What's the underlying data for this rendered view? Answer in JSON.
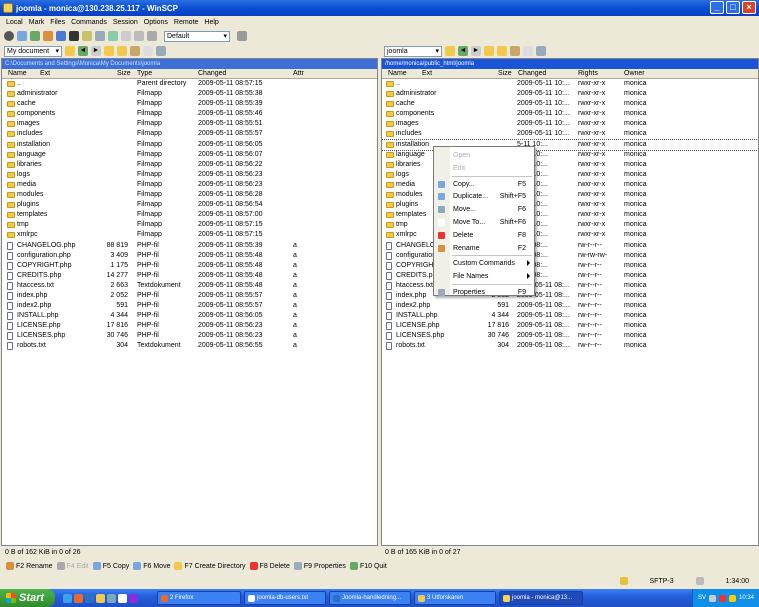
{
  "window": {
    "title": "joomla - monica@130.238.25.117 - WinSCP"
  },
  "menu": [
    "Local",
    "Mark",
    "Files",
    "Commands",
    "Session",
    "Options",
    "Remote",
    "Help"
  ],
  "toolbar": {
    "transfer_setting": "Default"
  },
  "left_path": {
    "drive": "My document"
  },
  "right_path": {
    "folder": "joomla"
  },
  "left_panel": {
    "address": "C:\\Documents and Settings\\Monica\\My Documents\\joomla",
    "columns": [
      "Name",
      "Ext",
      "Size",
      "Type",
      "Changed",
      "Attr"
    ],
    "rows": [
      {
        "name": "..",
        "ext": "",
        "size": "",
        "type": "Parent directory",
        "changed": "2009-05-11 08:57:15",
        "attr": "",
        "kind": "updir"
      },
      {
        "name": "administrator",
        "ext": "",
        "size": "",
        "type": "Filmapp",
        "changed": "2009-05-11 08:55:38",
        "attr": "",
        "kind": "folder"
      },
      {
        "name": "cache",
        "ext": "",
        "size": "",
        "type": "Filmapp",
        "changed": "2009-05-11 08:55:39",
        "attr": "",
        "kind": "folder"
      },
      {
        "name": "components",
        "ext": "",
        "size": "",
        "type": "Filmapp",
        "changed": "2009-05-11 08:55:46",
        "attr": "",
        "kind": "folder"
      },
      {
        "name": "images",
        "ext": "",
        "size": "",
        "type": "Filmapp",
        "changed": "2009-05-11 08:55:51",
        "attr": "",
        "kind": "folder"
      },
      {
        "name": "includes",
        "ext": "",
        "size": "",
        "type": "Filmapp",
        "changed": "2009-05-11 08:55:57",
        "attr": "",
        "kind": "folder"
      },
      {
        "name": "installation",
        "ext": "",
        "size": "",
        "type": "Filmapp",
        "changed": "2009-05-11 08:56:05",
        "attr": "",
        "kind": "folder"
      },
      {
        "name": "language",
        "ext": "",
        "size": "",
        "type": "Filmapp",
        "changed": "2009-05-11 08:56:07",
        "attr": "",
        "kind": "folder"
      },
      {
        "name": "libraries",
        "ext": "",
        "size": "",
        "type": "Filmapp",
        "changed": "2009-05-11 08:56:22",
        "attr": "",
        "kind": "folder"
      },
      {
        "name": "logs",
        "ext": "",
        "size": "",
        "type": "Filmapp",
        "changed": "2009-05-11 08:56:23",
        "attr": "",
        "kind": "folder"
      },
      {
        "name": "media",
        "ext": "",
        "size": "",
        "type": "Filmapp",
        "changed": "2009-05-11 08:56:23",
        "attr": "",
        "kind": "folder"
      },
      {
        "name": "modules",
        "ext": "",
        "size": "",
        "type": "Filmapp",
        "changed": "2009-05-11 08:56:28",
        "attr": "",
        "kind": "folder"
      },
      {
        "name": "plugins",
        "ext": "",
        "size": "",
        "type": "Filmapp",
        "changed": "2009-05-11 08:56:54",
        "attr": "",
        "kind": "folder"
      },
      {
        "name": "templates",
        "ext": "",
        "size": "",
        "type": "Filmapp",
        "changed": "2009-05-11 08:57:00",
        "attr": "",
        "kind": "folder"
      },
      {
        "name": "tmp",
        "ext": "",
        "size": "",
        "type": "Filmapp",
        "changed": "2009-05-11 08:57:15",
        "attr": "",
        "kind": "folder"
      },
      {
        "name": "xmlrpc",
        "ext": "",
        "size": "",
        "type": "Filmapp",
        "changed": "2009-05-11 08:57:15",
        "attr": "",
        "kind": "folder"
      },
      {
        "name": "CHANGELOG.php",
        "ext": "",
        "size": "88 819",
        "type": "PHP-fil",
        "changed": "2009-05-11 08:55:39",
        "attr": "a",
        "kind": "file"
      },
      {
        "name": "configuration.php",
        "ext": "",
        "size": "3 409",
        "type": "PHP-fil",
        "changed": "2009-05-11 08:55:48",
        "attr": "a",
        "kind": "file"
      },
      {
        "name": "COPYRIGHT.php",
        "ext": "",
        "size": "1 175",
        "type": "PHP-fil",
        "changed": "2009-05-11 08:55:48",
        "attr": "a",
        "kind": "file"
      },
      {
        "name": "CREDITS.php",
        "ext": "",
        "size": "14 277",
        "type": "PHP-fil",
        "changed": "2009-05-11 08:55:48",
        "attr": "a",
        "kind": "file"
      },
      {
        "name": "htaccess.txt",
        "ext": "",
        "size": "2 663",
        "type": "Textdokument",
        "changed": "2009-05-11 08:55:48",
        "attr": "a",
        "kind": "file"
      },
      {
        "name": "index.php",
        "ext": "",
        "size": "2 052",
        "type": "PHP-fil",
        "changed": "2009-05-11 08:55:57",
        "attr": "a",
        "kind": "file"
      },
      {
        "name": "index2.php",
        "ext": "",
        "size": "591",
        "type": "PHP-fil",
        "changed": "2009-05-11 08:55:57",
        "attr": "a",
        "kind": "file"
      },
      {
        "name": "INSTALL.php",
        "ext": "",
        "size": "4 344",
        "type": "PHP-fil",
        "changed": "2009-05-11 08:56:05",
        "attr": "a",
        "kind": "file"
      },
      {
        "name": "LICENSE.php",
        "ext": "",
        "size": "17 816",
        "type": "PHP-fil",
        "changed": "2009-05-11 08:56:23",
        "attr": "a",
        "kind": "file"
      },
      {
        "name": "LICENSES.php",
        "ext": "",
        "size": "30 746",
        "type": "PHP-fil",
        "changed": "2009-05-11 08:56:23",
        "attr": "a",
        "kind": "file"
      },
      {
        "name": "robots.txt",
        "ext": "",
        "size": "304",
        "type": "Textdokument",
        "changed": "2009-05-11 08:56:55",
        "attr": "a",
        "kind": "file"
      }
    ],
    "status": "0 B of 162 KiB in 0 of 26"
  },
  "right_panel": {
    "address": "/home/monica/public_html/joomla",
    "columns": [
      "Name",
      "Ext",
      "Size",
      "Changed",
      "Rights",
      "Owner"
    ],
    "rows": [
      {
        "name": "..",
        "size": "",
        "changed": "2009-05-11 10:...",
        "rights": "rwxr-xr-x",
        "owner": "monica",
        "kind": "updir"
      },
      {
        "name": "administrator",
        "size": "",
        "changed": "2009-05-11 10:...",
        "rights": "rwxr-xr-x",
        "owner": "monica",
        "kind": "folder"
      },
      {
        "name": "cache",
        "size": "",
        "changed": "2009-05-11 10:...",
        "rights": "rwxr-xr-x",
        "owner": "monica",
        "kind": "folder"
      },
      {
        "name": "components",
        "size": "",
        "changed": "2009-05-11 10:...",
        "rights": "rwxr-xr-x",
        "owner": "monica",
        "kind": "folder"
      },
      {
        "name": "images",
        "size": "",
        "changed": "2009-05-11 10:...",
        "rights": "rwxr-xr-x",
        "owner": "monica",
        "kind": "folder"
      },
      {
        "name": "includes",
        "size": "",
        "changed": "2009-05-11 10:...",
        "rights": "rwxr-xr-x",
        "owner": "monica",
        "kind": "folder"
      },
      {
        "name": "installation",
        "size": "",
        "changed": "5-11 10:...",
        "rights": "rwxr-xr-x",
        "owner": "monica",
        "kind": "folder",
        "selected": true
      },
      {
        "name": "language",
        "size": "",
        "changed": "5-11 10:...",
        "rights": "rwxr-xr-x",
        "owner": "monica",
        "kind": "folder"
      },
      {
        "name": "libraries",
        "size": "",
        "changed": "5-11 10:...",
        "rights": "rwxr-xr-x",
        "owner": "monica",
        "kind": "folder"
      },
      {
        "name": "logs",
        "size": "",
        "changed": "5-11 10:...",
        "rights": "rwxr-xr-x",
        "owner": "monica",
        "kind": "folder"
      },
      {
        "name": "media",
        "size": "",
        "changed": "5-11 10:...",
        "rights": "rwxr-xr-x",
        "owner": "monica",
        "kind": "folder"
      },
      {
        "name": "modules",
        "size": "",
        "changed": "5-11 10:...",
        "rights": "rwxr-xr-x",
        "owner": "monica",
        "kind": "folder"
      },
      {
        "name": "plugins",
        "size": "",
        "changed": "5-11 10:...",
        "rights": "rwxr-xr-x",
        "owner": "monica",
        "kind": "folder"
      },
      {
        "name": "templates",
        "size": "",
        "changed": "5-11 10:...",
        "rights": "rwxr-xr-x",
        "owner": "monica",
        "kind": "folder"
      },
      {
        "name": "tmp",
        "size": "",
        "changed": "5-11 10:...",
        "rights": "rwxr-xr-x",
        "owner": "monica",
        "kind": "folder"
      },
      {
        "name": "xmlrpc",
        "size": "",
        "changed": "5-11 10:...",
        "rights": "rwxr-xr-x",
        "owner": "monica",
        "kind": "folder"
      },
      {
        "name": "CHANGELOG.",
        "size": "",
        "changed": "5-11 08:...",
        "rights": "rw-r--r--",
        "owner": "monica",
        "kind": "file"
      },
      {
        "name": "configuration.",
        "size": "",
        "changed": "5-11 08:...",
        "rights": "rw-rw-rw-",
        "owner": "monica",
        "kind": "file"
      },
      {
        "name": "COPYRIGHT.",
        "size": "",
        "changed": "5-11 08:...",
        "rights": "rw-r--r--",
        "owner": "monica",
        "kind": "file"
      },
      {
        "name": "CREDITS.php",
        "size": "",
        "changed": "5-11 08:...",
        "rights": "rw-r--r--",
        "owner": "monica",
        "kind": "file"
      },
      {
        "name": "htaccess.txt",
        "size": "2 663",
        "changed": "2009-05-11 08:...",
        "rights": "rw-r--r--",
        "owner": "monica",
        "kind": "file"
      },
      {
        "name": "index.php",
        "size": "2 052",
        "changed": "2009-05-11 08:...",
        "rights": "rw-r--r--",
        "owner": "monica",
        "kind": "file"
      },
      {
        "name": "index2.php",
        "size": "591",
        "changed": "2009-05-11 08:...",
        "rights": "rw-r--r--",
        "owner": "monica",
        "kind": "file"
      },
      {
        "name": "INSTALL.php",
        "size": "4 344",
        "changed": "2009-05-11 08:...",
        "rights": "rw-r--r--",
        "owner": "monica",
        "kind": "file"
      },
      {
        "name": "LICENSE.php",
        "size": "17 816",
        "changed": "2009-05-11 08:...",
        "rights": "rw-r--r--",
        "owner": "monica",
        "kind": "file"
      },
      {
        "name": "LICENSES.php",
        "size": "30 746",
        "changed": "2009-05-11 08:...",
        "rights": "rw-r--r--",
        "owner": "monica",
        "kind": "file"
      },
      {
        "name": "robots.txt",
        "size": "304",
        "changed": "2009-05-11 08:...",
        "rights": "rw-r--r--",
        "owner": "monica",
        "kind": "file"
      }
    ],
    "status": "0 B of 165 KiB in 0 of 27"
  },
  "context_menu": [
    {
      "label": "Open",
      "key": "",
      "disabled": true
    },
    {
      "label": "Edit",
      "key": "",
      "disabled": true
    },
    {
      "sep": true
    },
    {
      "label": "Copy...",
      "key": "F5"
    },
    {
      "label": "Duplicate...",
      "key": "Shift+F5"
    },
    {
      "label": "Move...",
      "key": "F6"
    },
    {
      "label": "Move To...",
      "key": "Shift+F6"
    },
    {
      "label": "Delete",
      "key": "F8"
    },
    {
      "label": "Rename",
      "key": "F2"
    },
    {
      "sep": true
    },
    {
      "label": "Custom Commands",
      "key": "",
      "submenu": true
    },
    {
      "label": "File Names",
      "key": "",
      "submenu": true
    },
    {
      "sep": true
    },
    {
      "label": "Properties",
      "key": "F9"
    }
  ],
  "fkeys": [
    "F2 Rename",
    "F4 Edit",
    "F5 Copy",
    "F6 Move",
    "F7 Create Directory",
    "F8 Delete",
    "F9 Properties",
    "F10 Quit"
  ],
  "connection": {
    "protocol": "SFTP-3",
    "time": "1:34:00"
  },
  "taskbar": {
    "start": "Start",
    "tasks": [
      "2 Firefox",
      "joomla-db-users.txt",
      "Joomla-handledning...",
      "3 Utforskaren",
      "joomla - monica@13..."
    ],
    "clock": "10:34",
    "lang": "SV"
  },
  "colors": {
    "titlebar": "#0a4fd4",
    "selection": "#1a55d8",
    "folder": "#f2c94c"
  }
}
